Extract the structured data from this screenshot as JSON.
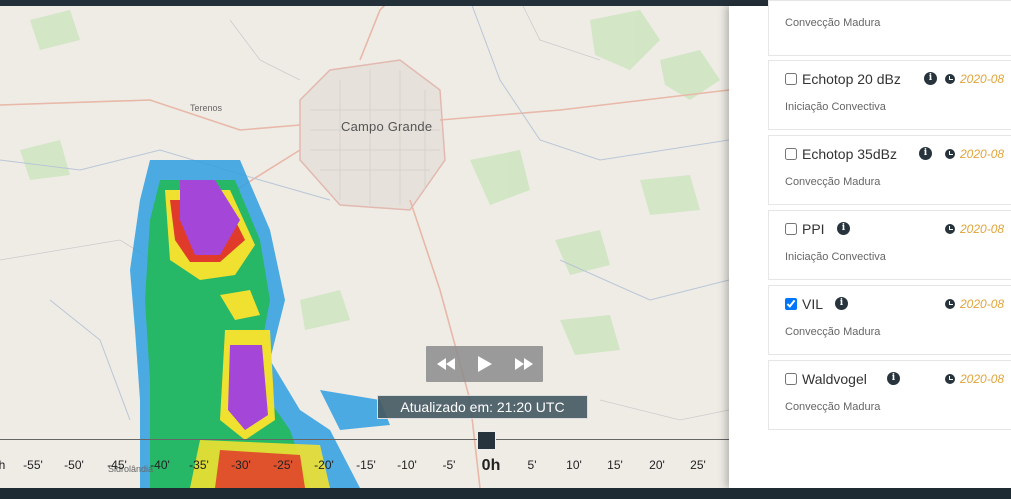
{
  "map": {
    "city": "Campo Grande",
    "towns": [
      "Terenos",
      "Sidrolândia"
    ]
  },
  "player": {
    "rewind_icon": "rewind-icon",
    "play_icon": "play-icon",
    "forward_icon": "fast-forward-icon",
    "status": "Atualizado em: 21:20 UTC"
  },
  "timeline": {
    "ticks": [
      "h",
      "-55'",
      "-50'",
      "-45'",
      "-40'",
      "-35'",
      "-30'",
      "-25'",
      "-20'",
      "-15'",
      "-10'",
      "-5'",
      "0h",
      "5'",
      "10'",
      "15'",
      "20'",
      "25'"
    ]
  },
  "layers": [
    {
      "name": "",
      "checked": false,
      "sub": "Convecção Madura",
      "date": ""
    },
    {
      "name": "Echotop 20 dBz",
      "checked": false,
      "sub": "Iniciação Convectiva",
      "date": "2020-08"
    },
    {
      "name": "Echotop 35dBz",
      "checked": false,
      "sub": "Convecção Madura",
      "date": "2020-08"
    },
    {
      "name": "PPI",
      "checked": false,
      "sub": "Iniciação Convectiva",
      "date": "2020-08"
    },
    {
      "name": "VIL",
      "checked": true,
      "sub": "Convecção Madura",
      "date": "2020-08"
    },
    {
      "name": "Waldvogel",
      "checked": false,
      "sub": "Convecção Madura",
      "date": "2020-08"
    }
  ],
  "colors": {
    "accent": "#e0a43a",
    "dark": "#27343d"
  }
}
